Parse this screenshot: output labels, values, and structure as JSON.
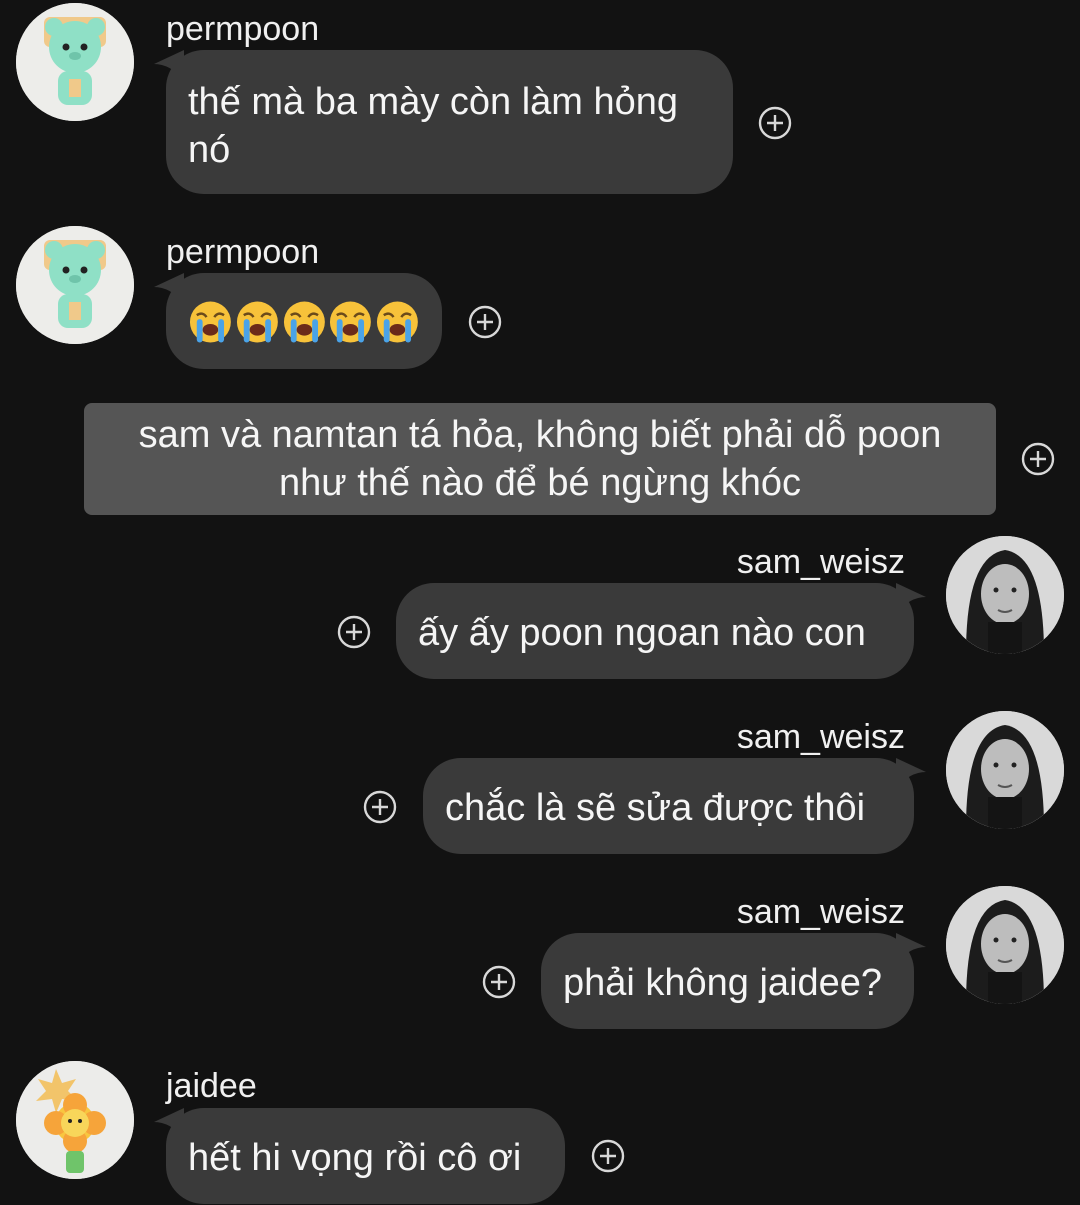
{
  "messages": [
    {
      "sender": "permpoon",
      "text": "thế mà ba mày còn làm hỏng\nnó"
    },
    {
      "sender": "permpoon",
      "text": "😭😭😭😭😭"
    },
    {
      "narration": "sam và namtan tá hỏa, không biết phải dỗ poon\nnhư thế nào để bé ngừng khóc"
    },
    {
      "sender": "sam_weisz",
      "text": "ấy ấy poon ngoan nào con"
    },
    {
      "sender": "sam_weisz",
      "text": "chắc là sẽ sửa được thôi"
    },
    {
      "sender": "sam_weisz",
      "text": "phải không jaidee?"
    },
    {
      "sender": "jaidee",
      "text": "hết hi vọng rồi cô ơi"
    }
  ],
  "icons": {
    "add_reaction": "plus-circle-icon",
    "avatar_permpoon": "mint-bear-cookie-avatar",
    "avatar_sam": "portrait-photo-avatar",
    "avatar_jaidee": "flower-cookie-avatar"
  },
  "colors": {
    "background": "#121212",
    "bubble": "#3a3a3a",
    "narration": "#555555",
    "text": "#f5f5f5"
  }
}
